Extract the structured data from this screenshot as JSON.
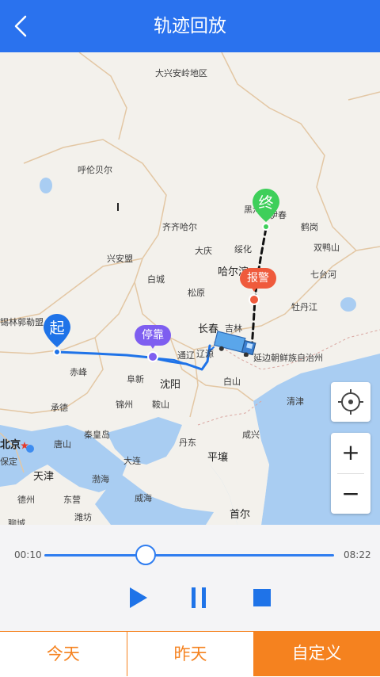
{
  "header": {
    "title": "轨迹回放",
    "back_icon": "chevron-left-icon"
  },
  "map": {
    "regions": [
      "大兴安岭地区",
      "呼伦贝尔",
      "齐齐哈尔",
      "兴安盟",
      "黑河",
      "伊春",
      "鹤岗",
      "绥化",
      "大庆",
      "双鸭山",
      "哈尔滨",
      "七台河",
      "白城",
      "松原",
      "牡丹江",
      "长春",
      "吉林",
      "延边朝鲜族自治州",
      "锡林郭勒盟",
      "赤峰",
      "通辽",
      "阜新",
      "沈阳",
      "辽源",
      "白山",
      "承德",
      "锦州",
      "鞍山",
      "清津",
      "秦皇岛",
      "唐山",
      "丹东",
      "咸兴",
      "大连",
      "平壤",
      "渤海",
      "天津",
      "保定",
      "东营",
      "威海",
      "首尔",
      "德州",
      "潍坊",
      "聊城"
    ],
    "capital": "北京",
    "markers": {
      "start": "起",
      "end": "终",
      "stop": "停靠",
      "alarm": "报警"
    },
    "colors": {
      "start": "#1f73e8",
      "end": "#3ecf5a",
      "stop": "#7e5ef0",
      "alarm": "#ef5a3c",
      "route": "#1f73e8"
    },
    "controls": {
      "locate_icon": "crosshair-icon",
      "zoom_in": "+",
      "zoom_out": "−"
    }
  },
  "player": {
    "start_time": "00:10",
    "end_time": "08:22",
    "progress": 0.35,
    "play_icon": "play-icon",
    "pause_icon": "pause-icon",
    "stop_icon": "stop-icon"
  },
  "tabs": [
    {
      "label": "今天",
      "active": false
    },
    {
      "label": "昨天",
      "active": false
    },
    {
      "label": "自定义",
      "active": true
    }
  ],
  "accent_color": "#2a72ee",
  "tab_color": "#f5821f"
}
